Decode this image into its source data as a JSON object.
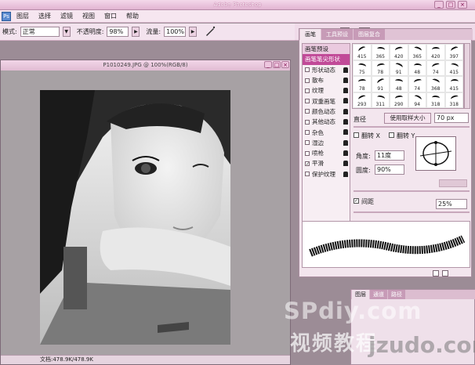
{
  "app": {
    "title": "Adobe Photoshop"
  },
  "menu": [
    "图层",
    "选择",
    "滤镜",
    "视图",
    "窗口",
    "帮助"
  ],
  "options": {
    "mode_label": "模式:",
    "mode_value": "正常",
    "opacity_label": "不透明度:",
    "opacity_value": "98%",
    "flow_label": "流量:",
    "flow_value": "100%"
  },
  "dock_tabs": [
    "画笔",
    "工具预设",
    "图层复合"
  ],
  "document": {
    "title": "P1010249.JPG @ 100%(RGB/8)",
    "status": "文档:478.9K/478.9K"
  },
  "brush_panel": {
    "left_items": [
      {
        "label": "画笔预设",
        "checkbox": false,
        "lock": false,
        "state": "header"
      },
      {
        "label": "画笔笔尖形状",
        "checkbox": false,
        "lock": false,
        "state": "selected"
      },
      {
        "label": "形状动态",
        "checkbox": true,
        "checked": false,
        "lock": true
      },
      {
        "label": "散布",
        "checkbox": true,
        "checked": false,
        "lock": true
      },
      {
        "label": "纹理",
        "checkbox": true,
        "checked": false,
        "lock": true
      },
      {
        "label": "双重画笔",
        "checkbox": true,
        "checked": false,
        "lock": true
      },
      {
        "label": "颜色动态",
        "checkbox": true,
        "checked": false,
        "lock": true
      },
      {
        "label": "其他动态",
        "checkbox": true,
        "checked": false,
        "lock": true
      },
      {
        "label": "杂色",
        "checkbox": true,
        "checked": false,
        "lock": true
      },
      {
        "label": "湿边",
        "checkbox": true,
        "checked": false,
        "lock": true
      },
      {
        "label": "喷枪",
        "checkbox": true,
        "checked": false,
        "lock": true
      },
      {
        "label": "平滑",
        "checkbox": true,
        "checked": true,
        "lock": true
      },
      {
        "label": "保护纹理",
        "checkbox": true,
        "checked": false,
        "lock": true
      }
    ],
    "brush_sizes": [
      "415",
      "365",
      "420",
      "365",
      "420",
      "397",
      "75",
      "78",
      "91",
      "48",
      "74",
      "415",
      "78",
      "91",
      "48",
      "74",
      "368",
      "415",
      "293",
      "311",
      "290",
      "94",
      "318",
      "318"
    ],
    "diameter_label": "直径",
    "sample_btn": "使用取样大小",
    "diameter_value": "70 px",
    "flip_x": "翻转 X",
    "flip_y": "翻转 Y",
    "angle_label": "角度:",
    "angle_value": "11度",
    "roundness_label": "圆度:",
    "roundness_value": "90%",
    "spacing_label": "间距",
    "spacing_value": "25%"
  },
  "layers_panel": {
    "tabs": [
      "图层",
      "通道",
      "路径"
    ]
  },
  "watermark": {
    "line1": "SPdiy.com",
    "line2": "视频教程",
    "line3": "jzudo.com"
  }
}
